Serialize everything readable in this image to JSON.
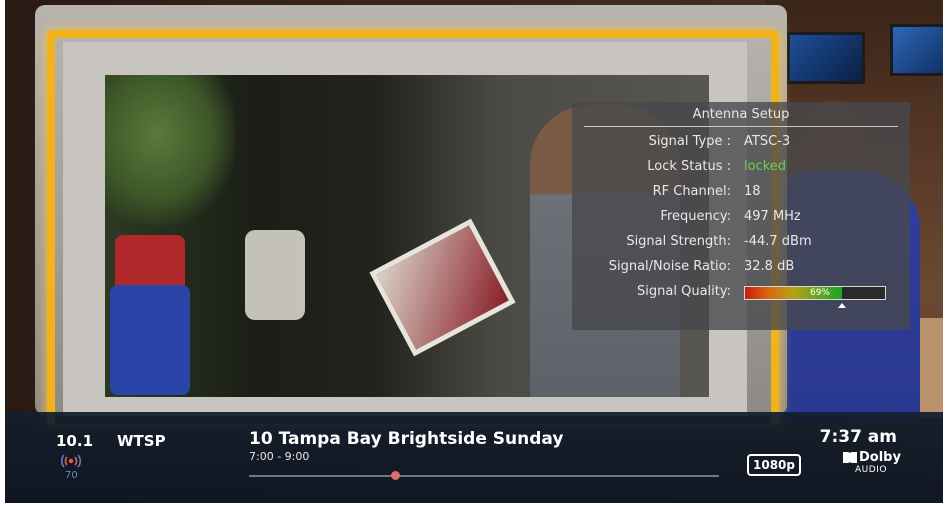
{
  "antenna_setup": {
    "title": "Antenna Setup",
    "rows": [
      {
        "label": "Signal Type :",
        "value": "ATSC-3"
      },
      {
        "label": "Lock Status :",
        "value": "locked"
      },
      {
        "label": "RF Channel:",
        "value": "18"
      },
      {
        "label": "Frequency:",
        "value": "497 MHz"
      },
      {
        "label": "Signal Strength:",
        "value": "-44.7 dBm"
      },
      {
        "label": "Signal/Noise Ratio:",
        "value": "32.8 dB"
      }
    ],
    "quality": {
      "label": "Signal Quality:",
      "value_text": "69%",
      "fraction": 0.69
    }
  },
  "info_bar": {
    "channel_number": "10.1",
    "channel_name": "WTSP",
    "signal_number": "70",
    "program_title": "10 Tampa Bay Brightside Sunday",
    "program_time": "7:00 - 9:00",
    "program_progress": 0.31,
    "clock": "7:37 am",
    "resolution": "1080p",
    "dolby_word": "Dolby",
    "dolby_sub": "AUDIO"
  },
  "colors": {
    "accent_glow": "#f2b21c",
    "locked_green": "#68d14e",
    "progress_dot": "#e06b6b"
  },
  "icons": {
    "signal": "broadcast-signal-icon",
    "dolby": "dolby-logo-icon"
  }
}
